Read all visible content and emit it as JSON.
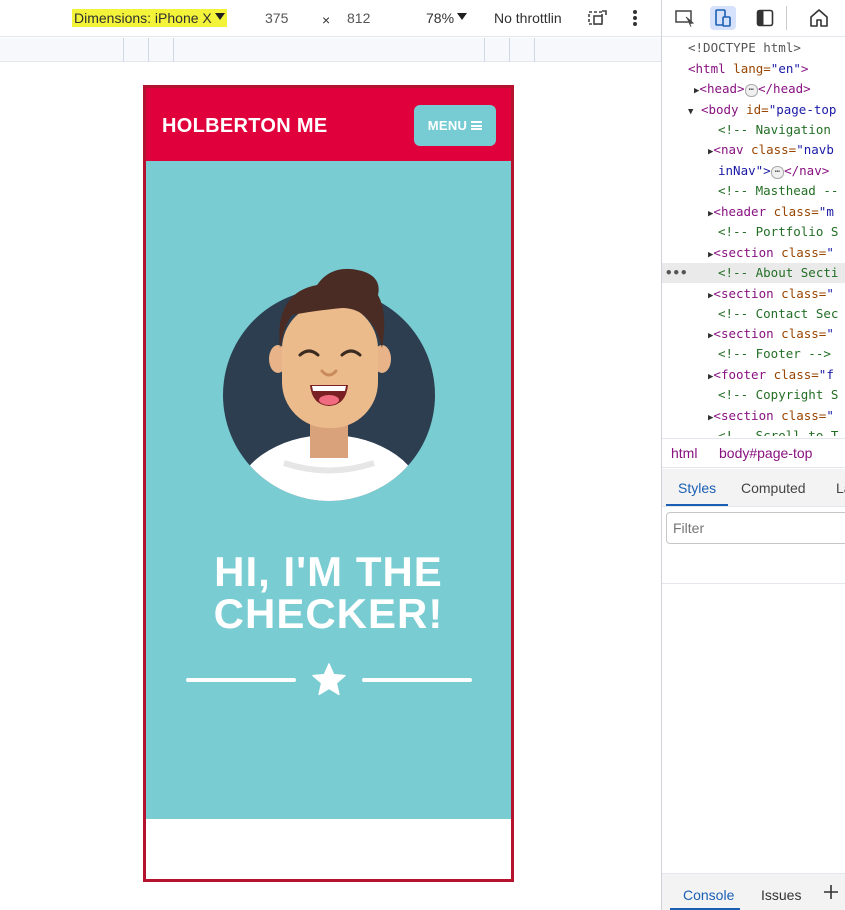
{
  "toolbar": {
    "dimensions_label": "Dimensions: iPhone X",
    "width": "375",
    "times": "×",
    "height": "812",
    "zoom": "78%",
    "throttling": "No throttlin"
  },
  "site": {
    "brand": "HOLBERTON ME",
    "menu_label": "MENU",
    "hero_title_line1": "HI, I'M THE",
    "hero_title_line2": "CHECKER!",
    "colors": {
      "nav": "#e0003b",
      "masthead": "#78ccd2",
      "menu_button": "#76ccd2"
    }
  },
  "devtools": {
    "tree": [
      {
        "text": "<!DOCTYPE html>"
      },
      {
        "open": "<html",
        "attr": " lang=",
        "val": "\"en\"",
        "close": ">"
      },
      {
        "open": "<head>",
        "close": "</head>"
      },
      {
        "open": "<body",
        "attr": " id=",
        "val": "\"page-top"
      },
      {
        "comment": "<!-- Navigation"
      },
      {
        "open": "<nav",
        "attr": " class=",
        "val": "\"navb"
      },
      {
        "val": "inNav\">",
        "close": "</nav>"
      },
      {
        "comment": "<!-- Masthead --"
      },
      {
        "open": "<header",
        "attr": " class=",
        "val": "\"m"
      },
      {
        "comment": "<!-- Portfolio S"
      },
      {
        "open": "<section",
        "attr": " class=",
        "val": "\""
      },
      {
        "comment": "<!-- About Secti"
      },
      {
        "open": "<section",
        "attr": " class=",
        "val": "\""
      },
      {
        "comment": "<!-- Contact Sec"
      },
      {
        "open": "<section",
        "attr": " class=",
        "val": "\""
      },
      {
        "comment": "<!-- Footer -->"
      },
      {
        "open": "<footer",
        "attr": " class=",
        "val": "\"f"
      },
      {
        "comment": "<!-- Copyright S"
      },
      {
        "open": "<section",
        "attr": " class=",
        "val": "\""
      },
      {
        "comment": "<!-- Scroll to T"
      }
    ],
    "crumb_html": "html",
    "crumb_body": "body#page-top",
    "styles_tab": "Styles",
    "computed_tab": "Computed",
    "layout_tab": "La",
    "filter_placeholder": "Filter",
    "console_tab": "Console",
    "issues_tab": "Issues"
  }
}
